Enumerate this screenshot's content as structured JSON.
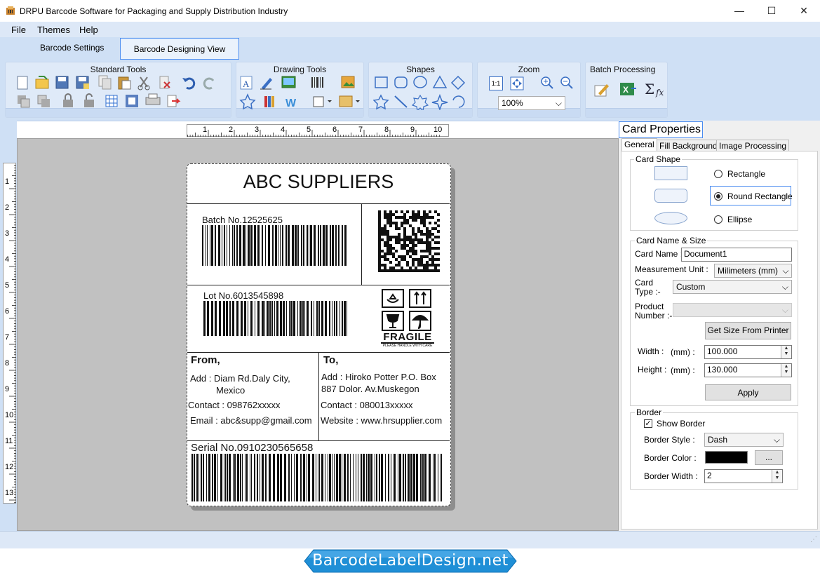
{
  "window": {
    "title": "DRPU Barcode Software for Packaging and Supply Distribution Industry",
    "minimize": "—",
    "maximize": "☐",
    "close": "✕"
  },
  "menu": {
    "file": "File",
    "themes": "Themes",
    "help": "Help"
  },
  "tabs": {
    "barcode_settings": "Barcode Settings",
    "designing_view": "Barcode Designing View"
  },
  "ribbon": {
    "standard_tools": "Standard Tools",
    "drawing_tools": "Drawing Tools",
    "shapes": "Shapes",
    "zoom": "Zoom",
    "zoom_value": "100%",
    "zoom_fit_label": "1:1",
    "batch_processing": "Batch Processing",
    "sigma_label": "Σ",
    "fx_label": "fx"
  },
  "rulers": {
    "horizontal": [
      "1",
      "2",
      "3",
      "4",
      "5",
      "6",
      "7",
      "8",
      "9",
      "10"
    ],
    "vertical": [
      "1",
      "2",
      "3",
      "4",
      "5",
      "6",
      "7",
      "8",
      "9",
      "10",
      "11",
      "12",
      "13"
    ]
  },
  "label": {
    "company": "ABC SUPPLIERS",
    "batch": "Batch No.12525625",
    "lot": "Lot No.6013545898",
    "fragile": "FRAGILE",
    "fragile_sub": "PLEASE HANDLE WITH CARE",
    "from_heading": "From,",
    "from_add_1": "Add : Diam Rd.Daly City,",
    "from_add_2": "Mexico",
    "from_contact": "Contact : 098762xxxxx",
    "from_email": "Email : abc&supp@gmail.com",
    "to_heading": "To,",
    "to_add_1": "Add : Hiroko Potter P.O. Box",
    "to_add_2": "887  Dolor. Av.Muskegon",
    "to_contact": "Contact : 080013xxxxx",
    "to_website": "Website : www.hrsupplier.com",
    "serial": "Serial No.0910230565658"
  },
  "properties": {
    "title": "Card Properties",
    "tabs": [
      "General",
      "Fill Background",
      "Image Processing"
    ],
    "card_shape": {
      "legend": "Card Shape",
      "options": [
        "Rectangle",
        "Round Rectangle",
        "Ellipse"
      ],
      "selected": "Round Rectangle"
    },
    "card_name_size": {
      "legend": "Card  Name & Size",
      "card_name_label": "Card Name :",
      "card_name_value": "Document1",
      "measurement_label": "Measurement Unit :",
      "measurement_value": "Milimeters (mm)",
      "card_type_label_1": "Card",
      "card_type_label_2": "Type :-",
      "card_type_value": "Custom",
      "product_label_1": "Product",
      "product_label_2": "Number :-",
      "product_value": "",
      "get_size_button": "Get Size From Printer",
      "width_label": "Width :",
      "height_label": "Height :",
      "unit_label": "(mm) :",
      "width_value": "100.000",
      "height_value": "130.000",
      "apply_button": "Apply"
    },
    "border": {
      "legend": "Border",
      "show_border_label": "Show Border",
      "show_border_checked": true,
      "style_label": "Border Style :",
      "style_value": "Dash",
      "color_label": "Border Color :",
      "color_value": "#000000",
      "color_button": "...",
      "width_label": "Border Width :",
      "width_value": "2"
    }
  },
  "banner": {
    "text": "BarcodeLabelDesign.net"
  },
  "colors": {
    "accent": "#4a8cf0",
    "ribbon": "#cfe0f5",
    "canvas": "#c1c1c1",
    "banner": "#1f8fd6"
  }
}
